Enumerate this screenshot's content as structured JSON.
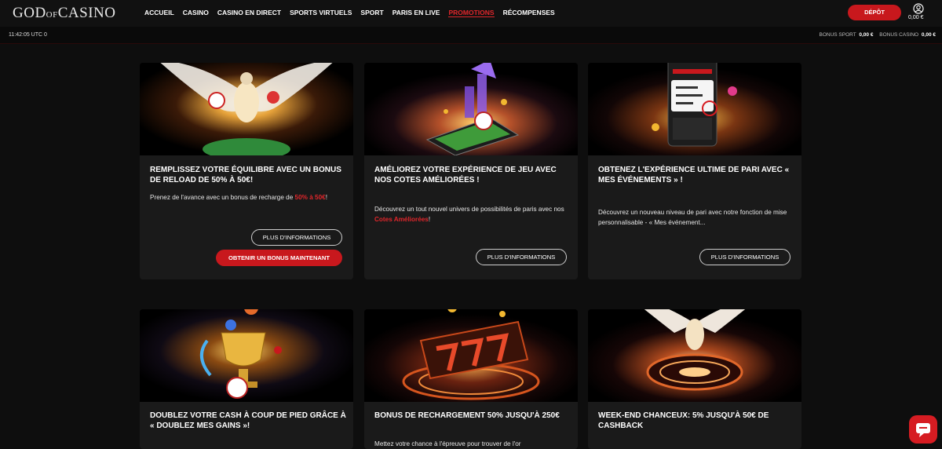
{
  "header": {
    "logo": {
      "part1": "GOD",
      "part2": "OF",
      "part3": "CASINO"
    },
    "nav": [
      {
        "label": "ACCUEIL"
      },
      {
        "label": "CASINO"
      },
      {
        "label": "CASINO EN DIRECT"
      },
      {
        "label": "SPORTS VIRTUELS"
      },
      {
        "label": "SPORT"
      },
      {
        "label": "PARIS EN LIVE"
      },
      {
        "label": "PROMOTIONS",
        "active": true
      },
      {
        "label": "RÉCOMPENSES"
      }
    ],
    "deposit_label": "DÉPÔT",
    "balance": "0,00 €",
    "user_icon": "user-circle-icon"
  },
  "subbar": {
    "time": "11:42:05 UTC 0",
    "bonus_sport_label": "BONUS SPORT",
    "bonus_sport_value": "0,00 €",
    "bonus_casino_label": "BONUS CASINO",
    "bonus_casino_value": "0,00 €"
  },
  "cards": [
    {
      "title": "REMPLISSEZ VOTRE ÉQUILIBRE AVEC UN BONUS DE RELOAD DE 50% À 50€!",
      "desc_pre": "Prenez de l'avance avec un bonus de recharge de ",
      "desc_hl": "50% à 50€",
      "desc_post": "!",
      "more_label": "PLUS D'INFORMATIONS",
      "cta_label": "OBTENIR UN BONUS MAINTENANT"
    },
    {
      "title": "AMÉLIOREZ VOTRE EXPÉRIENCE DE JEU AVEC NOS COTES AMÉLIORÉES !",
      "desc_pre": "Découvrez un tout nouvel univers de possibilités de paris avec nos ",
      "desc_hl": "Cotes Améliorées",
      "desc_post": "!",
      "more_label": "PLUS D'INFORMATIONS"
    },
    {
      "title": "OBTENEZ L'EXPÉRIENCE ULTIME DE PARI AVEC « MES ÉVÉNEMENTS » !",
      "desc_pre": "Découvrez un nouveau niveau de pari avec notre fonction de mise personnalisable - « Mes événement...",
      "more_label": "PLUS D'INFORMATIONS"
    },
    {
      "title": "DOUBLEZ VOTRE CASH À COUP DE PIED GRÂCE À « DOUBLEZ MES GAINS »!"
    },
    {
      "title": "BONUS DE RECHARGEMENT 50% JUSQU'À 250€",
      "desc_pre": "Mettez votre chance à l'épreuve pour trouver de l'or"
    },
    {
      "title": "WEEK-END CHANCEUX: 5% JUSQU'À 50€ DE CASHBACK"
    }
  ],
  "colors": {
    "accent": "#c8181d",
    "background": "#0e0e0e",
    "card": "#1a1a1a"
  },
  "chat_icon": "chat-bubble-icon"
}
